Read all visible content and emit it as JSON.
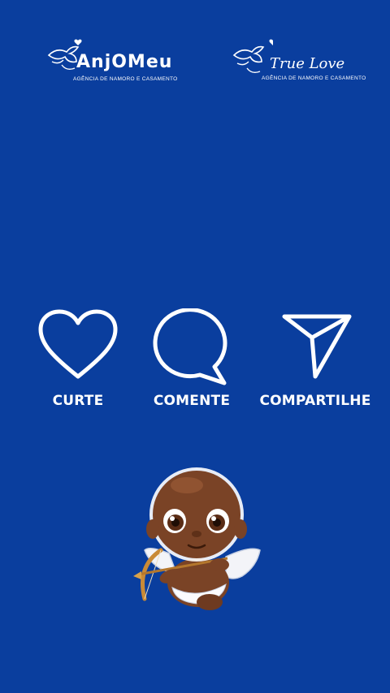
{
  "logos": {
    "anjo_meu": {
      "name": "AnjOMeu",
      "tagline": "AGÊNCIA DE NAMORO E CASAMENTO",
      "icon": "cupid-heart-icon"
    },
    "true_love": {
      "name": "True Love",
      "tagline": "AGÊNCIA DE NAMORO E CASAMENTO",
      "icon": "cupid-heart-icon"
    }
  },
  "actions": [
    {
      "label": "CURTE",
      "icon": "heart-icon"
    },
    {
      "label": "COMENTE",
      "icon": "speech-bubble-icon"
    },
    {
      "label": "COMPARTILHE",
      "icon": "send-icon"
    }
  ],
  "illustration": {
    "icon": "cupid-illustration"
  },
  "colors": {
    "background": "#0a3e9e",
    "foreground": "#ffffff",
    "skin": "#7a4326"
  }
}
